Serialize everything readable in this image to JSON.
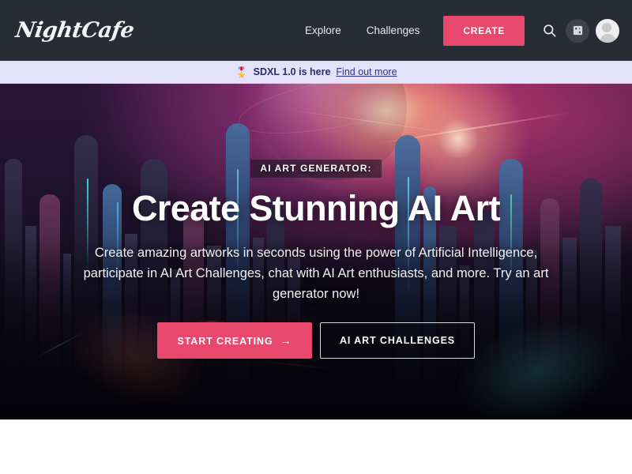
{
  "header": {
    "logo_text": "NightCafe",
    "nav_links": [
      {
        "label": "Explore",
        "name": "nav-link-explore"
      },
      {
        "label": "Challenges",
        "name": "nav-link-challenges"
      }
    ],
    "create_button": "CREATE",
    "search_icon": "search-icon",
    "gallery_icon": "dice-image-icon",
    "avatar_icon": "user-avatar",
    "background_color": "#282c34",
    "accent_color": "#e8486b"
  },
  "announcement": {
    "emoji": "🎖️",
    "text": "SDXL 1.0 is here",
    "link_label": "Find out more",
    "background_color": "#e4e2fb",
    "text_color": "#2e2a6b"
  },
  "hero": {
    "eyebrow": "AI ART GENERATOR:",
    "headline": "Create Stunning AI Art",
    "subcopy": "Create amazing artworks in seconds using the power of Artificial Intelligence, participate in AI Art Challenges, chat with AI Art enthusiasts, and more. Try an art generator now!",
    "primary_cta": "START CREATING",
    "primary_cta_arrow": "→",
    "secondary_cta": "AI ART CHALLENGES",
    "background_description": "Futuristic neon cyberpunk cityscape at dusk with magenta sky, sun flare and a large planet"
  }
}
